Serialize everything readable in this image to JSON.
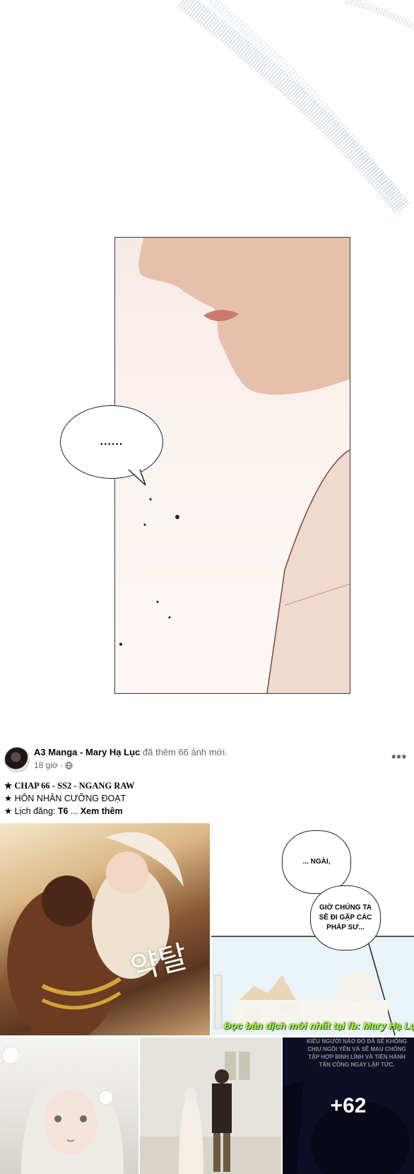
{
  "manga": {
    "bubble_text": "......"
  },
  "post": {
    "author": "A3 Manga - Mary Hạ Lục",
    "action": "đã thêm 66 ảnh mới.",
    "time": "18 giờ ·",
    "privacy_icon": "globe-icon",
    "more_icon": "more-options-icon",
    "more_label": "•••",
    "caption": {
      "line1": "★ CHAP 66 - SS2 - NGANG RAW",
      "line2": "★ HÔN NHÂN CƯỠNG ĐOẠT",
      "line3_prefix": "★ Lịch đăng: ",
      "line3_bold": "T6",
      "line3_ellipsis": " ... ",
      "see_more": "Xem thêm"
    }
  },
  "photos": {
    "p1": {
      "title_art": "약탈"
    },
    "p2": {
      "bubble1": "... NGÀI,",
      "bubble2": "GIỜ CHÚNG TA SẼ ĐI GẶP CÁC PHÁP SƯ...",
      "watermark": "Đọc bản dịch mới nhất tại fb: Mary Hạ Lục"
    },
    "p5": {
      "caption": "KIỂU NGƯỜI NÀO ĐÓ ĐÃ SẼ KHÔNG CHỊU NGỒI YÊN VÀ SẼ MAU CHÓNG TẬP HỢP BINH LÍNH VÀ TIẾN HÀNH TẤN CÔNG NGAY LẬP TỨC.",
      "more_count": "+62"
    }
  },
  "colors": {
    "secondary_text": "#65676b",
    "watermark": "#b7f24a",
    "p5_bg": "#1b1a46"
  }
}
